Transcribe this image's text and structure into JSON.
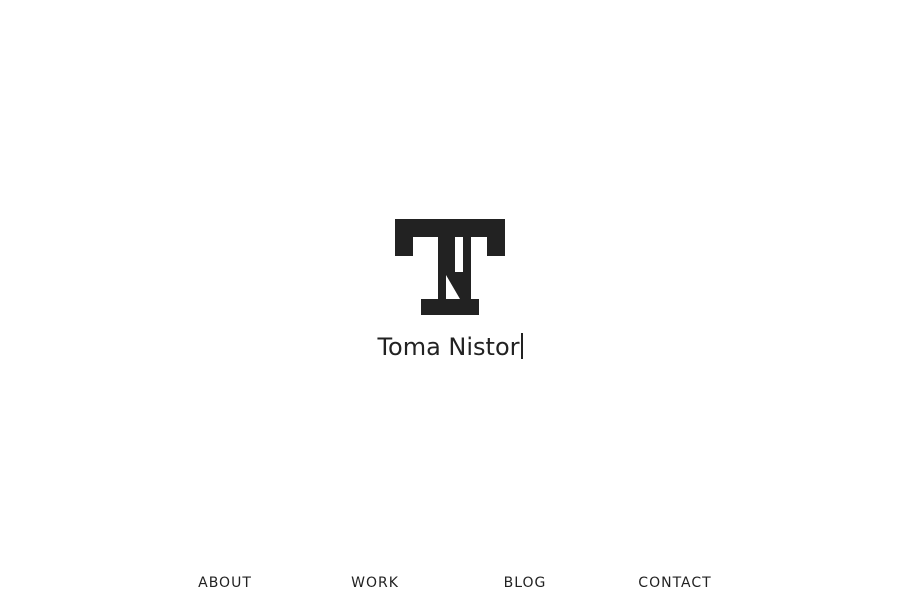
{
  "logo": {
    "icon": "tn-monogram-icon",
    "color": "#222222"
  },
  "site_name": "Toma Nistor",
  "nav": {
    "items": [
      {
        "label": "ABOUT"
      },
      {
        "label": "WORK"
      },
      {
        "label": "BLOG"
      },
      {
        "label": "CONTACT"
      }
    ]
  }
}
